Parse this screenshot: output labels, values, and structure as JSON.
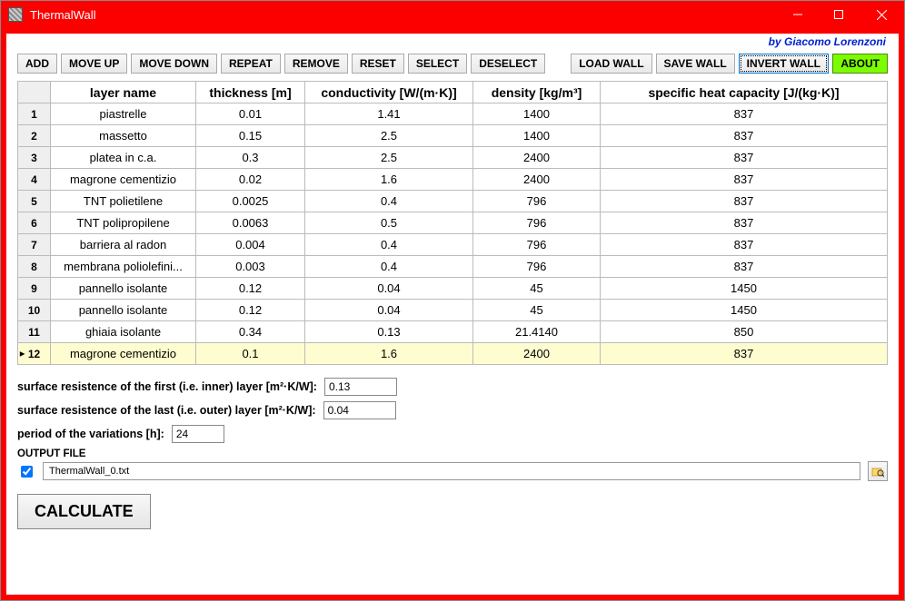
{
  "window": {
    "title": "ThermalWall"
  },
  "byline": "by Giacomo Lorenzoni",
  "toolbar": {
    "add": "ADD",
    "move_up": "MOVE UP",
    "move_down": "MOVE DOWN",
    "repeat": "REPEAT",
    "remove": "REMOVE",
    "reset": "RESET",
    "select": "SELECT",
    "deselect": "DESELECT",
    "load_wall": "LOAD WALL",
    "save_wall": "SAVE WALL",
    "invert_wall": "INVERT WALL",
    "about": "ABOUT"
  },
  "table": {
    "headers": {
      "layer_name": "layer name",
      "thickness": "thickness  [m]",
      "conductivity": "conductivity  [W/(m·K)]",
      "density": "density  [kg/m³]",
      "shc": "specific heat capacity  [J/(kg·K)]"
    },
    "rows": [
      {
        "n": "1",
        "name": "piastrelle",
        "thickness": "0.01",
        "conductivity": "1.41",
        "density": "1400",
        "shc": "837"
      },
      {
        "n": "2",
        "name": "massetto",
        "thickness": "0.15",
        "conductivity": "2.5",
        "density": "1400",
        "shc": "837"
      },
      {
        "n": "3",
        "name": "platea in c.a.",
        "thickness": "0.3",
        "conductivity": "2.5",
        "density": "2400",
        "shc": "837"
      },
      {
        "n": "4",
        "name": "magrone cementizio",
        "thickness": "0.02",
        "conductivity": "1.6",
        "density": "2400",
        "shc": "837"
      },
      {
        "n": "5",
        "name": "TNT polietilene",
        "thickness": "0.0025",
        "conductivity": "0.4",
        "density": "796",
        "shc": "837"
      },
      {
        "n": "6",
        "name": "TNT polipropilene",
        "thickness": "0.0063",
        "conductivity": "0.5",
        "density": "796",
        "shc": "837"
      },
      {
        "n": "7",
        "name": "barriera al radon",
        "thickness": "0.004",
        "conductivity": "0.4",
        "density": "796",
        "shc": "837"
      },
      {
        "n": "8",
        "name": "membrana poliolefini...",
        "thickness": "0.003",
        "conductivity": "0.4",
        "density": "796",
        "shc": "837"
      },
      {
        "n": "9",
        "name": "pannello isolante",
        "thickness": "0.12",
        "conductivity": "0.04",
        "density": "45",
        "shc": "1450"
      },
      {
        "n": "10",
        "name": "pannello isolante",
        "thickness": "0.12",
        "conductivity": "0.04",
        "density": "45",
        "shc": "1450"
      },
      {
        "n": "11",
        "name": "ghiaia isolante",
        "thickness": "0.34",
        "conductivity": "0.13",
        "density": "21.4140",
        "shc": "850"
      },
      {
        "n": "12",
        "name": "magrone cementizio",
        "thickness": "0.1",
        "conductivity": "1.6",
        "density": "2400",
        "shc": "837"
      }
    ],
    "selected_index": 11
  },
  "inputs": {
    "inner_res_label": "surface resistence of the first (i.e. inner) layer [m²·K/W]:",
    "inner_res_value": "0.13",
    "outer_res_label": "surface resistence of the last (i.e. outer) layer [m²·K/W]:",
    "outer_res_value": "0.04",
    "period_label": "period of the variations [h]:",
    "period_value": "24",
    "output_file_label": "OUTPUT FILE",
    "output_file_value": "ThermalWall_0.txt",
    "output_file_checked": true
  },
  "calculate": "CALCULATE"
}
